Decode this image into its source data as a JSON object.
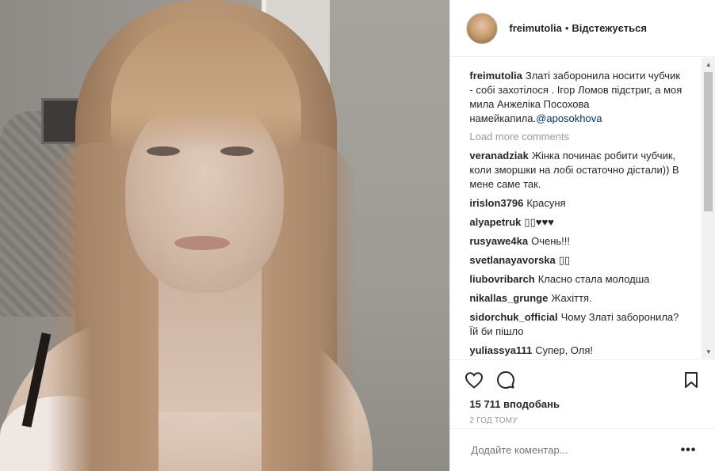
{
  "header": {
    "username": "freimutolia",
    "separator": "•",
    "follow_label": "Відстежується"
  },
  "caption": {
    "username": "freimutolia",
    "text": "Златі заборонила носити чубчик - собі захотілося . Ігор Ломов підстриг, а моя мила Анжеліка Посохова намейкапила.",
    "mention": "@aposokhova"
  },
  "load_more": "Load more comments",
  "comments": [
    {
      "user": "veranadziak",
      "text": "Жінка починає робити чубчик, коли зморшки на лобі остаточно дістали)) В мене саме так."
    },
    {
      "user": "irislon3796",
      "text": "Красуня"
    },
    {
      "user": "alyapetruk",
      "text": "▯▯♥♥♥"
    },
    {
      "user": "rusyawe4ka",
      "text": "Очень!!!"
    },
    {
      "user": "svetlanayavorska",
      "text": "▯▯"
    },
    {
      "user": "liubovribarch",
      "text": "Класно стала молодша"
    },
    {
      "user": "nikallas_grunge",
      "text": "Жахіття."
    },
    {
      "user": "sidorchuk_official",
      "text": "Чому Златі заборонила? Їй би пішло"
    },
    {
      "user": "yuliassya111",
      "text": "Супер, Оля!"
    }
  ],
  "likes": "15 711 вподобань",
  "time": "2 год тому",
  "add_comment_placeholder": "Додайте коментар...",
  "more_label": "•••",
  "icons": {
    "like": "heart-icon",
    "comment": "comment-icon",
    "save": "bookmark-icon"
  }
}
